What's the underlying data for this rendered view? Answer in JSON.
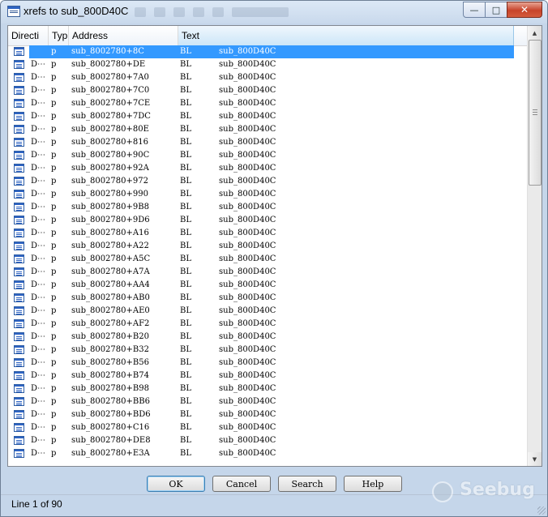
{
  "window": {
    "title": "xrefs to sub_800D40C",
    "controls": {
      "minimize": "—",
      "maximize": "□",
      "close": "✕"
    }
  },
  "columns": [
    "Directi",
    "Typ",
    "Address",
    "Text"
  ],
  "rows": [
    {
      "dir": "",
      "type": "p",
      "address": "sub_8002780+8C",
      "instr": "BL",
      "operand": "sub_800D40C"
    },
    {
      "dir": "D⋯",
      "type": "p",
      "address": "sub_8002780+DE",
      "instr": "BL",
      "operand": "sub_800D40C"
    },
    {
      "dir": "D⋯",
      "type": "p",
      "address": "sub_8002780+7A0",
      "instr": "BL",
      "operand": "sub_800D40C"
    },
    {
      "dir": "D⋯",
      "type": "p",
      "address": "sub_8002780+7C0",
      "instr": "BL",
      "operand": "sub_800D40C"
    },
    {
      "dir": "D⋯",
      "type": "p",
      "address": "sub_8002780+7CE",
      "instr": "BL",
      "operand": "sub_800D40C"
    },
    {
      "dir": "D⋯",
      "type": "p",
      "address": "sub_8002780+7DC",
      "instr": "BL",
      "operand": "sub_800D40C"
    },
    {
      "dir": "D⋯",
      "type": "p",
      "address": "sub_8002780+80E",
      "instr": "BL",
      "operand": "sub_800D40C"
    },
    {
      "dir": "D⋯",
      "type": "p",
      "address": "sub_8002780+816",
      "instr": "BL",
      "operand": "sub_800D40C"
    },
    {
      "dir": "D⋯",
      "type": "p",
      "address": "sub_8002780+90C",
      "instr": "BL",
      "operand": "sub_800D40C"
    },
    {
      "dir": "D⋯",
      "type": "p",
      "address": "sub_8002780+92A",
      "instr": "BL",
      "operand": "sub_800D40C"
    },
    {
      "dir": "D⋯",
      "type": "p",
      "address": "sub_8002780+972",
      "instr": "BL",
      "operand": "sub_800D40C"
    },
    {
      "dir": "D⋯",
      "type": "p",
      "address": "sub_8002780+990",
      "instr": "BL",
      "operand": "sub_800D40C"
    },
    {
      "dir": "D⋯",
      "type": "p",
      "address": "sub_8002780+9B8",
      "instr": "BL",
      "operand": "sub_800D40C"
    },
    {
      "dir": "D⋯",
      "type": "p",
      "address": "sub_8002780+9D6",
      "instr": "BL",
      "operand": "sub_800D40C"
    },
    {
      "dir": "D⋯",
      "type": "p",
      "address": "sub_8002780+A16",
      "instr": "BL",
      "operand": "sub_800D40C"
    },
    {
      "dir": "D⋯",
      "type": "p",
      "address": "sub_8002780+A22",
      "instr": "BL",
      "operand": "sub_800D40C"
    },
    {
      "dir": "D⋯",
      "type": "p",
      "address": "sub_8002780+A5C",
      "instr": "BL",
      "operand": "sub_800D40C"
    },
    {
      "dir": "D⋯",
      "type": "p",
      "address": "sub_8002780+A7A",
      "instr": "BL",
      "operand": "sub_800D40C"
    },
    {
      "dir": "D⋯",
      "type": "p",
      "address": "sub_8002780+AA4",
      "instr": "BL",
      "operand": "sub_800D40C"
    },
    {
      "dir": "D⋯",
      "type": "p",
      "address": "sub_8002780+AB0",
      "instr": "BL",
      "operand": "sub_800D40C"
    },
    {
      "dir": "D⋯",
      "type": "p",
      "address": "sub_8002780+AE0",
      "instr": "BL",
      "operand": "sub_800D40C"
    },
    {
      "dir": "D⋯",
      "type": "p",
      "address": "sub_8002780+AF2",
      "instr": "BL",
      "operand": "sub_800D40C"
    },
    {
      "dir": "D⋯",
      "type": "p",
      "address": "sub_8002780+B20",
      "instr": "BL",
      "operand": "sub_800D40C"
    },
    {
      "dir": "D⋯",
      "type": "p",
      "address": "sub_8002780+B32",
      "instr": "BL",
      "operand": "sub_800D40C"
    },
    {
      "dir": "D⋯",
      "type": "p",
      "address": "sub_8002780+B56",
      "instr": "BL",
      "operand": "sub_800D40C"
    },
    {
      "dir": "D⋯",
      "type": "p",
      "address": "sub_8002780+B74",
      "instr": "BL",
      "operand": "sub_800D40C"
    },
    {
      "dir": "D⋯",
      "type": "p",
      "address": "sub_8002780+B98",
      "instr": "BL",
      "operand": "sub_800D40C"
    },
    {
      "dir": "D⋯",
      "type": "p",
      "address": "sub_8002780+BB6",
      "instr": "BL",
      "operand": "sub_800D40C"
    },
    {
      "dir": "D⋯",
      "type": "p",
      "address": "sub_8002780+BD6",
      "instr": "BL",
      "operand": "sub_800D40C"
    },
    {
      "dir": "D⋯",
      "type": "p",
      "address": "sub_8002780+C16",
      "instr": "BL",
      "operand": "sub_800D40C"
    },
    {
      "dir": "D⋯",
      "type": "p",
      "address": "sub_8002780+DE8",
      "instr": "BL",
      "operand": "sub_800D40C"
    },
    {
      "dir": "D⋯",
      "type": "p",
      "address": "sub_8002780+E3A",
      "instr": "BL",
      "operand": "sub_800D40C"
    }
  ],
  "buttons": {
    "ok": "OK",
    "cancel": "Cancel",
    "search": "Search",
    "help": "Help"
  },
  "status": {
    "text": "Line 1 of 90"
  },
  "watermark": {
    "text": "Seebug"
  },
  "scrollbar": {
    "up_arrow": "▲",
    "down_arrow": "▼"
  }
}
